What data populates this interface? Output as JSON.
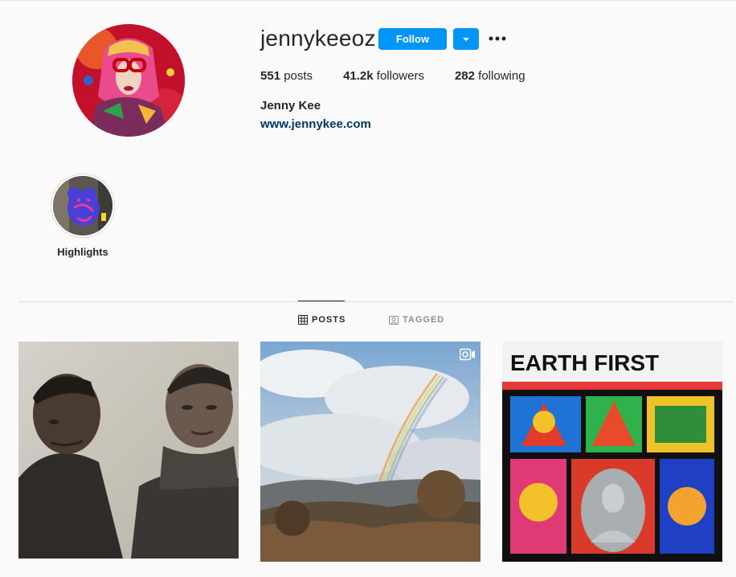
{
  "profile": {
    "username": "jennykeeoz",
    "full_name": "Jenny Kee",
    "website": "www.jennykee.com",
    "follow_label": "Follow",
    "stats": {
      "posts_count": "551",
      "posts_label": "posts",
      "followers_count": "41.2k",
      "followers_label": "followers",
      "following_count": "282",
      "following_label": "following"
    }
  },
  "highlights": [
    {
      "label": "Highlights"
    }
  ],
  "tabs": [
    {
      "label": "POSTS",
      "icon": "grid-icon",
      "active": true
    },
    {
      "label": "TAGGED",
      "icon": "tagged-icon",
      "active": false
    }
  ],
  "posts": [
    {
      "name": "black-and-white-portrait-photo",
      "is_video": false
    },
    {
      "name": "rainbow-landscape-photo",
      "is_video": true
    },
    {
      "name": "earth-first-textile-photo",
      "is_video": false
    }
  ],
  "post_3_texts": {
    "earth_first": "EARTH FIRST"
  },
  "colors": {
    "accent": "#0095f6",
    "link": "#00376b",
    "text": "#262626",
    "muted": "#8e8e8e",
    "background": "#fafafa"
  }
}
